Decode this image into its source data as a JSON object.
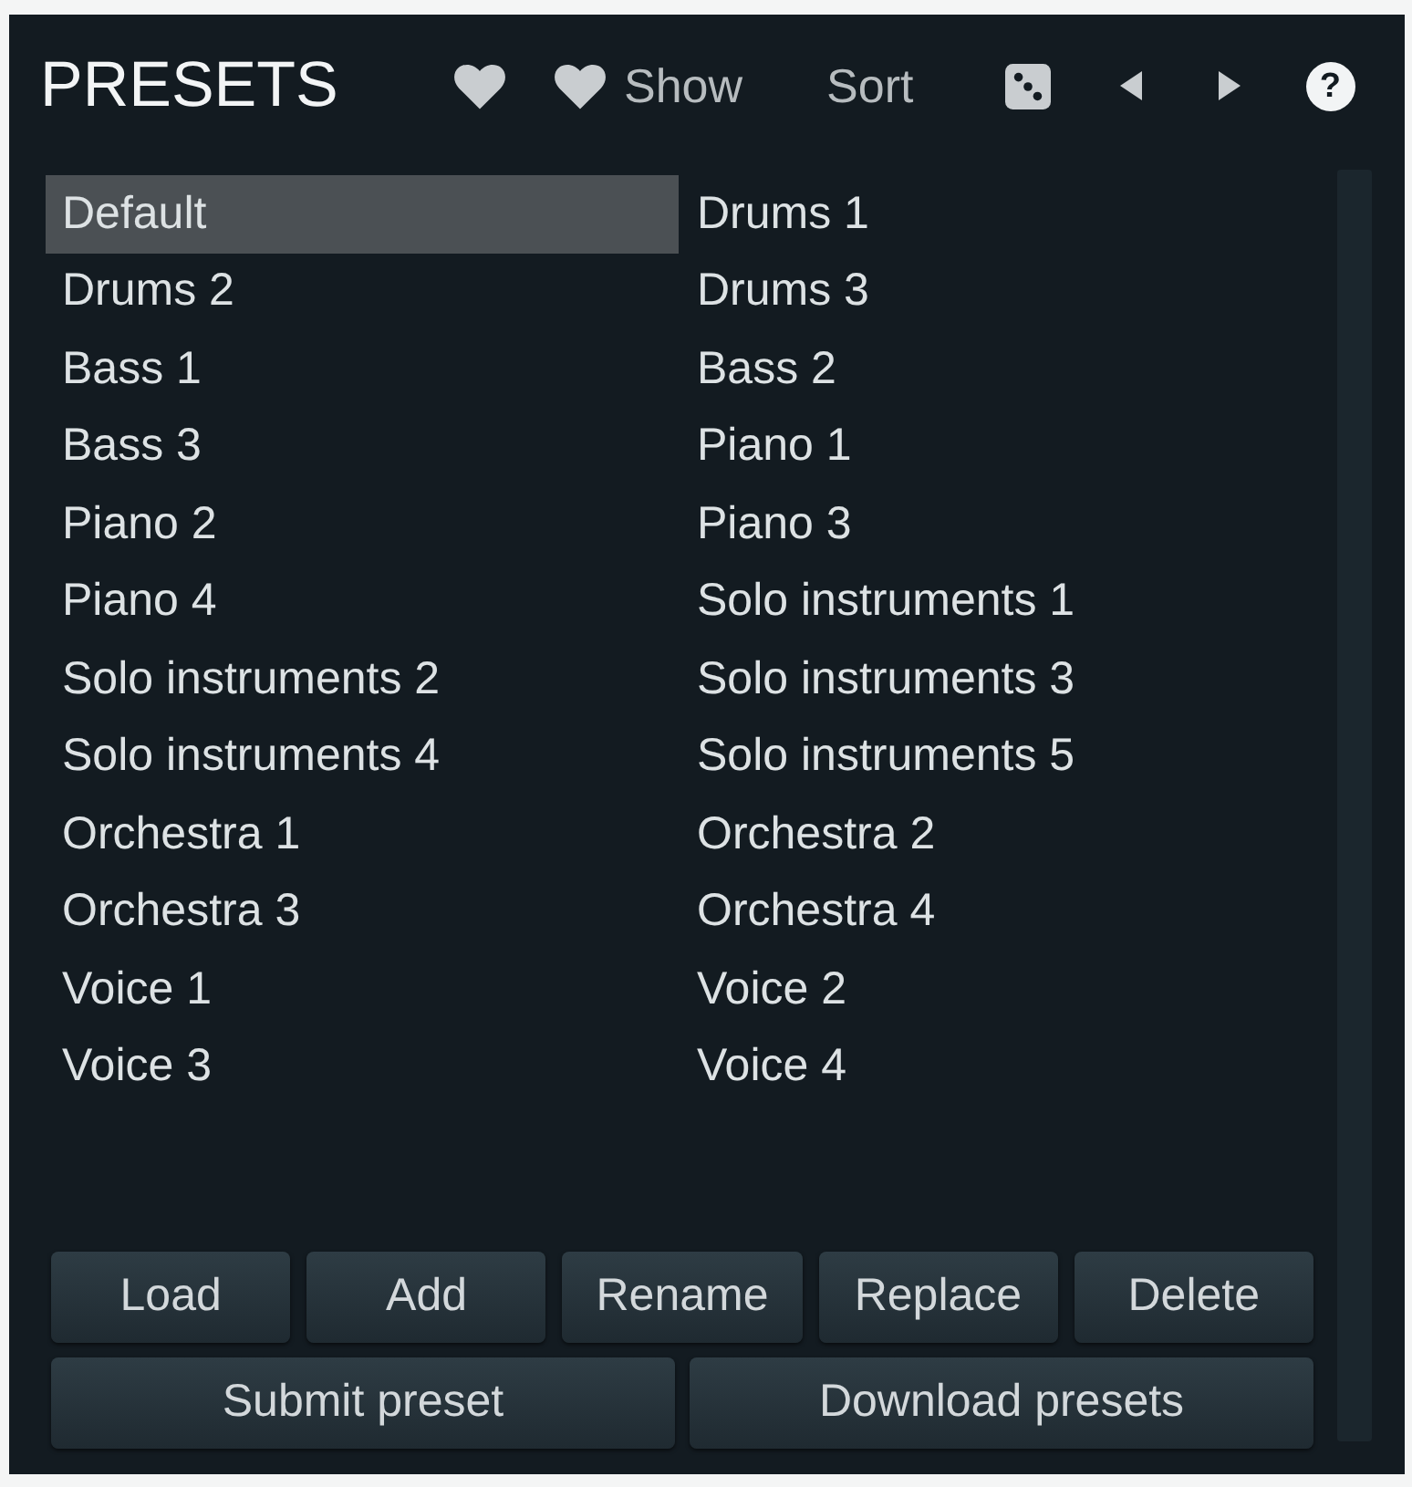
{
  "header": {
    "title": "PRESETS",
    "show_label": "Show",
    "sort_label": "Sort",
    "help_label": "?"
  },
  "presets": [
    {
      "name": "Default",
      "selected": true
    },
    {
      "name": "Drums 1",
      "selected": false
    },
    {
      "name": "Drums 2",
      "selected": false
    },
    {
      "name": "Drums 3",
      "selected": false
    },
    {
      "name": "Bass 1",
      "selected": false
    },
    {
      "name": "Bass 2",
      "selected": false
    },
    {
      "name": "Bass 3",
      "selected": false
    },
    {
      "name": "Piano 1",
      "selected": false
    },
    {
      "name": "Piano 2",
      "selected": false
    },
    {
      "name": "Piano 3",
      "selected": false
    },
    {
      "name": "Piano 4",
      "selected": false
    },
    {
      "name": "Solo instruments 1",
      "selected": false
    },
    {
      "name": "Solo instruments 2",
      "selected": false
    },
    {
      "name": "Solo instruments 3",
      "selected": false
    },
    {
      "name": "Solo instruments 4",
      "selected": false
    },
    {
      "name": "Solo instruments 5",
      "selected": false
    },
    {
      "name": "Orchestra 1",
      "selected": false
    },
    {
      "name": "Orchestra 2",
      "selected": false
    },
    {
      "name": "Orchestra 3",
      "selected": false
    },
    {
      "name": "Orchestra 4",
      "selected": false
    },
    {
      "name": "Voice 1",
      "selected": false
    },
    {
      "name": "Voice 2",
      "selected": false
    },
    {
      "name": "Voice 3",
      "selected": false
    },
    {
      "name": "Voice 4",
      "selected": false
    }
  ],
  "buttons": [
    {
      "label": "Load"
    },
    {
      "label": "Add"
    },
    {
      "label": "Rename"
    },
    {
      "label": "Replace"
    },
    {
      "label": "Delete"
    }
  ],
  "bottom_buttons": [
    {
      "label": "Submit preset"
    },
    {
      "label": "Download presets"
    }
  ]
}
